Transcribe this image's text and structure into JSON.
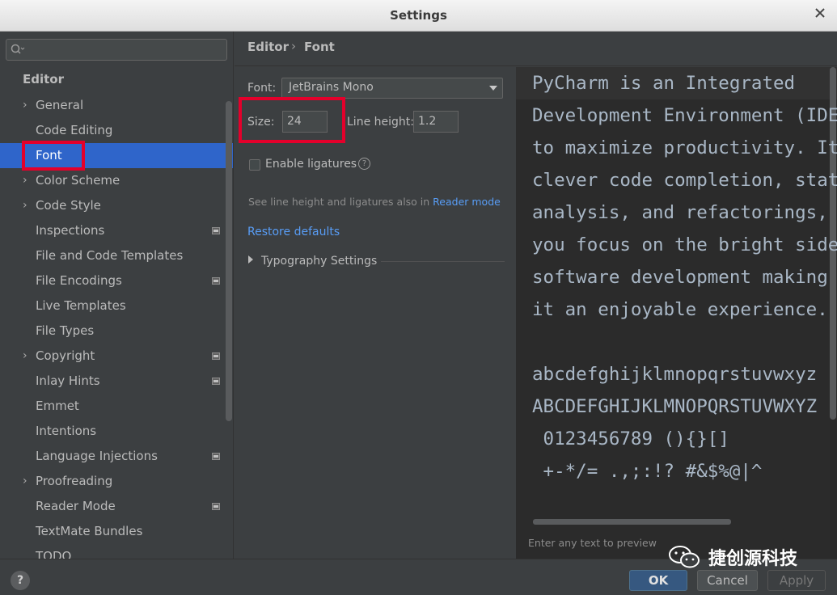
{
  "window": {
    "title": "Settings"
  },
  "sidebar": {
    "search_placeholder": "",
    "group": "Editor",
    "items": [
      {
        "label": "General",
        "expandable": true,
        "project": false
      },
      {
        "label": "Code Editing",
        "expandable": false,
        "project": false
      },
      {
        "label": "Font",
        "expandable": false,
        "project": false,
        "selected": true
      },
      {
        "label": "Color Scheme",
        "expandable": true,
        "project": false
      },
      {
        "label": "Code Style",
        "expandable": true,
        "project": false
      },
      {
        "label": "Inspections",
        "expandable": false,
        "project": true
      },
      {
        "label": "File and Code Templates",
        "expandable": false,
        "project": false
      },
      {
        "label": "File Encodings",
        "expandable": false,
        "project": true
      },
      {
        "label": "Live Templates",
        "expandable": false,
        "project": false
      },
      {
        "label": "File Types",
        "expandable": false,
        "project": false
      },
      {
        "label": "Copyright",
        "expandable": true,
        "project": true
      },
      {
        "label": "Inlay Hints",
        "expandable": false,
        "project": true
      },
      {
        "label": "Emmet",
        "expandable": false,
        "project": false
      },
      {
        "label": "Intentions",
        "expandable": false,
        "project": false
      },
      {
        "label": "Language Injections",
        "expandable": false,
        "project": true
      },
      {
        "label": "Proofreading",
        "expandable": true,
        "project": false
      },
      {
        "label": "Reader Mode",
        "expandable": false,
        "project": true
      },
      {
        "label": "TextMate Bundles",
        "expandable": false,
        "project": false
      },
      {
        "label": "TODO",
        "expandable": false,
        "project": false
      }
    ]
  },
  "breadcrumb": {
    "parent": "Editor",
    "separator": "›",
    "current": "Font"
  },
  "font_settings": {
    "font_label": "Font:",
    "font_value": "JetBrains Mono",
    "size_label": "Size:",
    "size_value": "24",
    "line_height_label": "Line height:",
    "line_height_value": "1.2",
    "ligatures_label": "Enable ligatures",
    "ligatures_checked": false,
    "hint_prefix": "See line height and ligatures also in ",
    "hint_link": "Reader mode",
    "restore_label": "Restore defaults",
    "typography_label": "Typography Settings"
  },
  "preview": {
    "lines": [
      "PyCharm is an Integrated",
      "Development Environment (IDE) used",
      "to maximize productivity. It provides",
      "clever code completion, static code",
      "analysis, and refactorings, and lets",
      "you focus on the bright side of",
      "software development making",
      "it an enjoyable experience.",
      "",
      "abcdefghijklmnopqrstuvwxyz",
      "ABCDEFGHIJKLMNOPQRSTUVWXYZ",
      " 0123456789 (){}[]",
      " +-*/= .,;:!? #&$%@|^"
    ],
    "hint": "Enter any text to preview"
  },
  "buttons": {
    "help": "?",
    "ok": "OK",
    "cancel": "Cancel",
    "apply": "Apply"
  },
  "watermark": {
    "text": "捷创源科技"
  },
  "colors": {
    "accent": "#2f65ca",
    "highlight": "#e4002b",
    "link": "#589df6"
  }
}
